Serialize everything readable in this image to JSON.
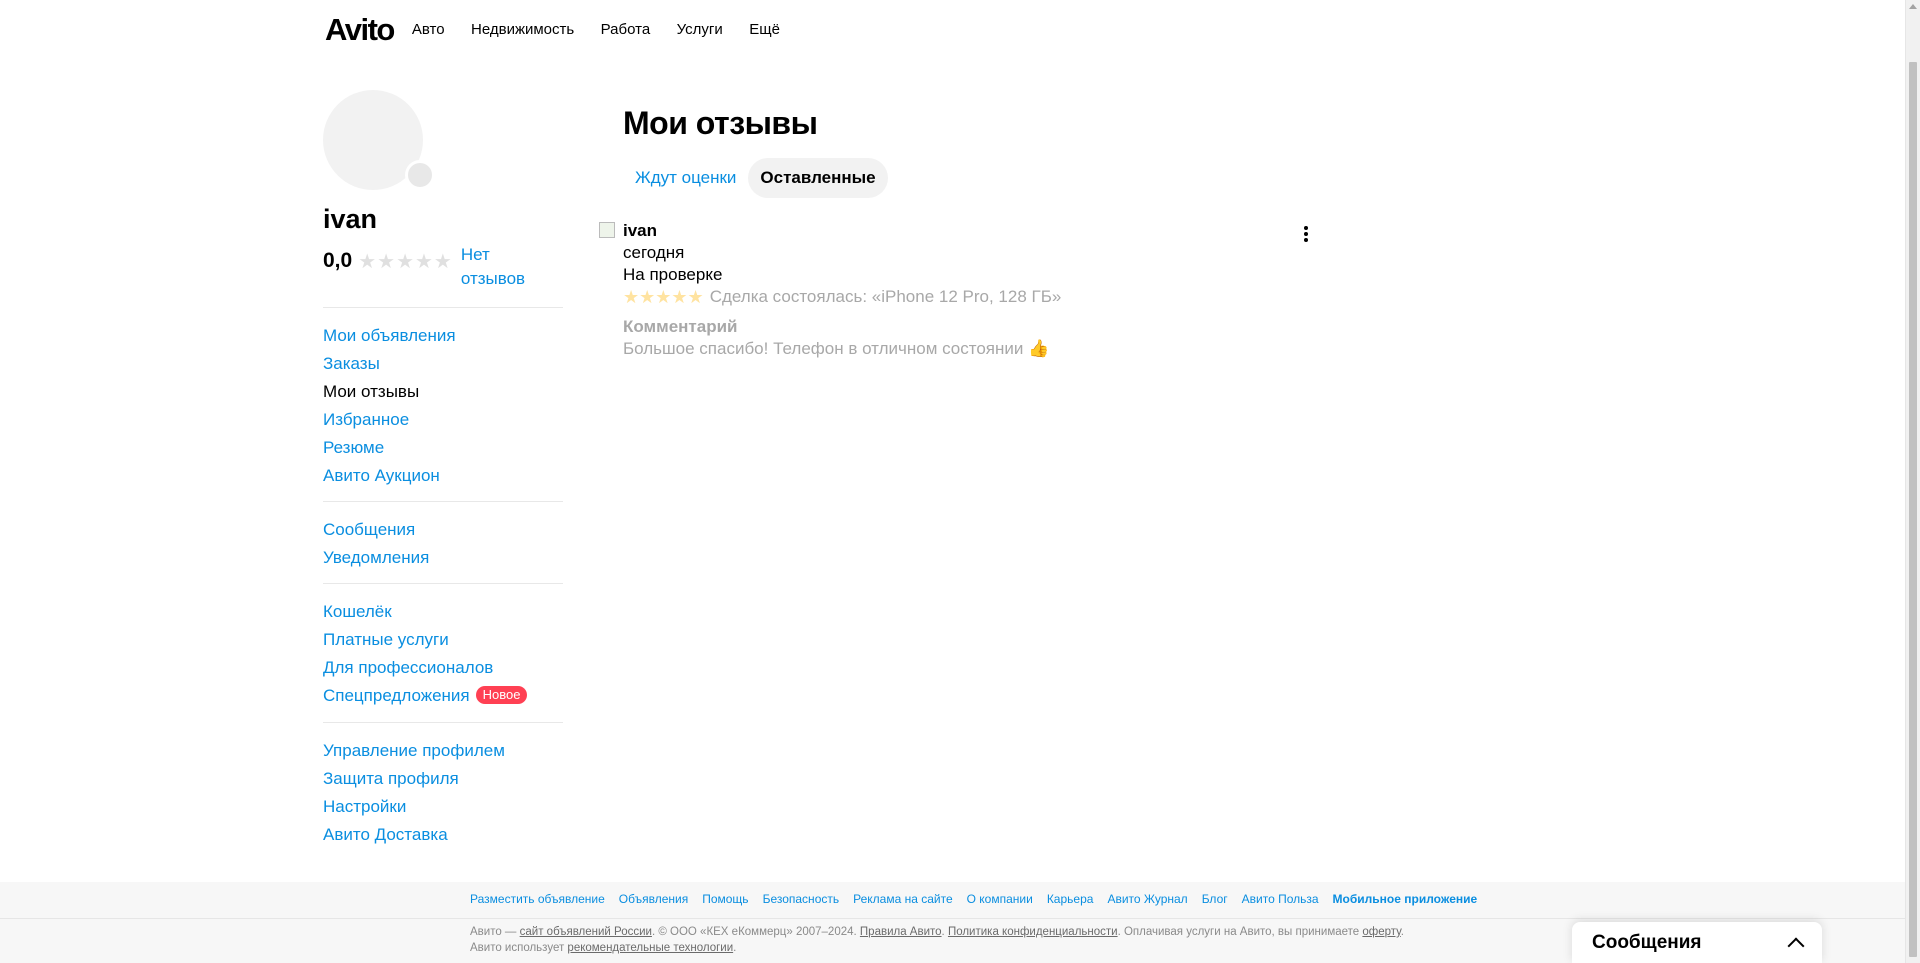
{
  "header": {
    "logo": "Avito",
    "nav": [
      "Авто",
      "Недвижимость",
      "Работа",
      "Услуги",
      "Ещё"
    ]
  },
  "profile": {
    "name": "ivan",
    "rating": "0,0",
    "stars_filled": 0,
    "stars_total": 5,
    "no_reviews": "Нет отзывов"
  },
  "sidebar": {
    "group1": [
      "Мои объявления",
      "Заказы",
      "Мои отзывы",
      "Избранное",
      "Резюме",
      "Авито Аукцион"
    ],
    "group2": [
      "Сообщения",
      "Уведомления"
    ],
    "group3": [
      "Кошелёк",
      "Платные услуги",
      "Для профессионалов",
      "Спецпредложения"
    ],
    "group3_badge": "Новое",
    "group4": [
      "Управление профилем",
      "Защита профиля",
      "Настройки",
      "Авито Доставка"
    ]
  },
  "main": {
    "title": "Мои отзывы",
    "tabs": [
      "Ждут оценки",
      "Оставленные"
    ],
    "active_tab": "Оставленные"
  },
  "review": {
    "author": "ivan",
    "date": "сегодня",
    "status": "На проверке",
    "stars": 5,
    "deal": "Сделка состоялась: «iPhone 12 Pro, 128 ГБ»",
    "comment_label": "Комментарий",
    "comment": "Большое спасибо! Телефон в отличном состоянии",
    "comment_emoji": "thumbs-up-icon"
  },
  "footer": {
    "links": [
      "Разместить объявление",
      "Объявления",
      "Помощь",
      "Безопасность",
      "Реклама на сайте",
      "О компании",
      "Карьера",
      "Авито Журнал",
      "Блог",
      "Авито Польза",
      "Мобильное приложение"
    ],
    "legal": {
      "p1": "Авито — ",
      "l1": "сайт объявлений России",
      "p2": ". © ООО «КЕХ еКоммерц» 2007–2024. ",
      "l2": "Правила Авито",
      "p3": ". ",
      "l3": "Политика конфиденциальности",
      "p4": ". Оплачивая услуги на Авито, вы принимаете ",
      "l4": "оферту",
      "p5": ". Авито использует ",
      "l5": "рекомендательные технологии",
      "p6": "."
    }
  },
  "messages_widget": {
    "label": "Сообщения"
  },
  "colors": {
    "link": "#0a8ee0",
    "badge": "#ff4053",
    "muted": "#a8a8a8"
  }
}
